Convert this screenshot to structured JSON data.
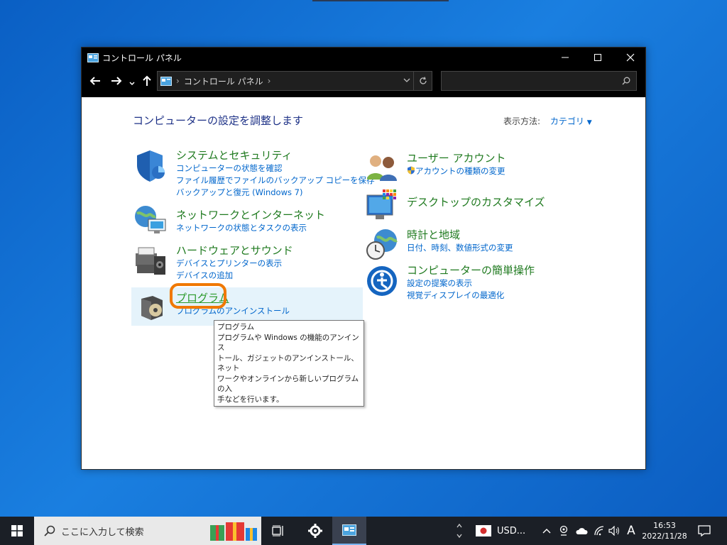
{
  "window": {
    "title": "コントロール パネル",
    "address": "コントロール パネル",
    "search_placeholder": ""
  },
  "content": {
    "heading": "コンピューターの設定を調整します",
    "view_by_label": "表示方法:",
    "view_by_value": "カテゴリ"
  },
  "categories": {
    "system": {
      "title": "システムとセキュリティ",
      "links": [
        "コンピューターの状態を確認",
        "ファイル履歴でファイルのバックアップ コピーを保存",
        "バックアップと復元 (Windows 7)"
      ]
    },
    "network": {
      "title": "ネットワークとインターネット",
      "links": [
        "ネットワークの状態とタスクの表示"
      ]
    },
    "hardware": {
      "title": "ハードウェアとサウンド",
      "links": [
        "デバイスとプリンターの表示",
        "デバイスの追加"
      ]
    },
    "programs": {
      "title": "プログラム",
      "links": [
        "プログラムのアンインストール"
      ]
    },
    "users": {
      "title": "ユーザー アカウント",
      "links": [
        "アカウントの種類の変更"
      ]
    },
    "desktop": {
      "title": "デスクトップのカスタマイズ",
      "links": []
    },
    "clock": {
      "title": "時計と地域",
      "links": [
        "日付、時刻、数値形式の変更"
      ]
    },
    "ease": {
      "title": "コンピューターの簡単操作",
      "links": [
        "設定の提案の表示",
        "視覚ディスプレイの最適化"
      ]
    }
  },
  "tooltip": {
    "lines": [
      "プログラム",
      "プログラムや Windows の機能のアンインス",
      "トール、ガジェットのアンインストール、ネット",
      "ワークやオンラインから新しいプログラムの入",
      "手などを行います。"
    ]
  },
  "taskbar": {
    "search_placeholder": "ここに入力して検索",
    "currency": "USD...",
    "ime": "A",
    "time": "16:53",
    "date": "2022/11/28"
  },
  "colors": {
    "accent": "#0066cc",
    "category_title": "#1f7a1f",
    "highlight_ring": "#f07800"
  }
}
